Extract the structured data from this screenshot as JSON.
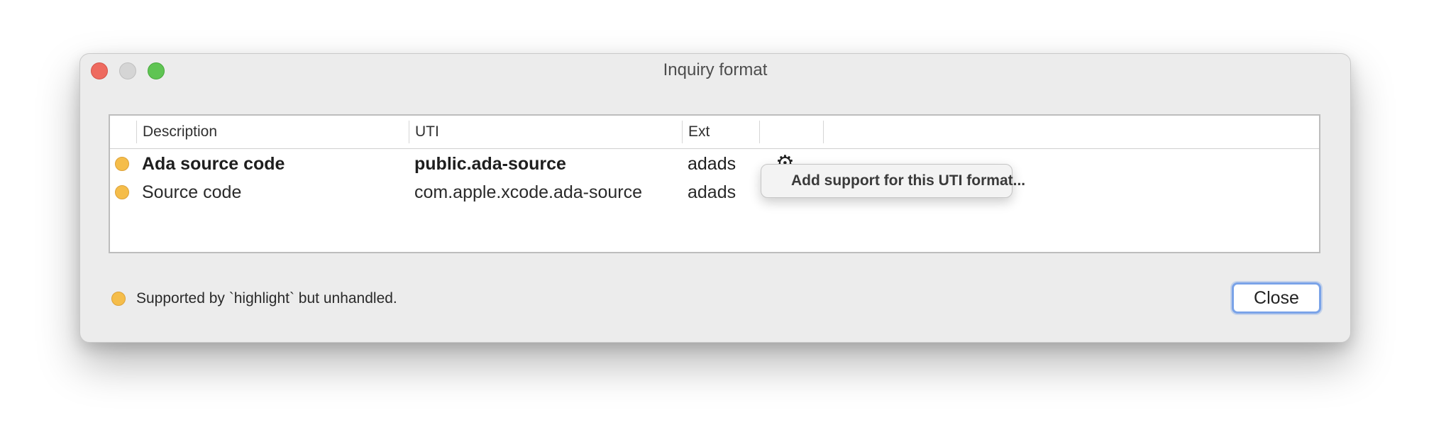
{
  "window": {
    "title": "Inquiry format"
  },
  "table": {
    "columns": [
      "",
      "Description",
      "UTI",
      "Ext",
      ""
    ],
    "rows": [
      {
        "status_color": "#f5bd4a",
        "description": "Ada source code",
        "uti": "public.ada-source",
        "ext": "adads",
        "bold": true,
        "icon": "gear-icon"
      },
      {
        "status_color": "#f5bd4a",
        "description": "Source code",
        "uti": "com.apple.xcode.ada-source",
        "ext": "adads",
        "bold": false,
        "icon": "gear-icon"
      }
    ]
  },
  "context_menu": {
    "items": [
      "Add support for this UTI format..."
    ]
  },
  "legend": {
    "color": "#f5bd4a",
    "text": "Supported by `highlight` but unhandled."
  },
  "buttons": {
    "close_label": "Close"
  }
}
